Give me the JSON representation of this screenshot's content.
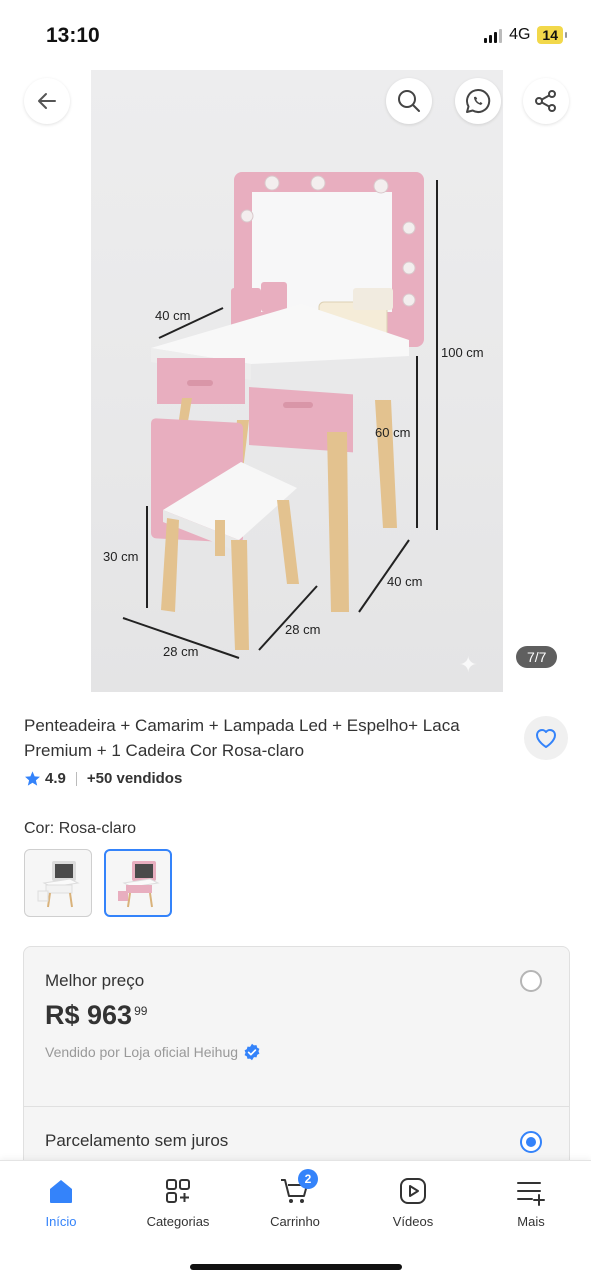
{
  "status_bar": {
    "time": "13:10",
    "network": "4G",
    "battery": "14"
  },
  "header": {
    "back_icon": "arrow-left-icon",
    "actions": [
      "search-icon",
      "whatsapp-icon",
      "share-icon"
    ]
  },
  "gallery": {
    "counter": "7/7",
    "dimensions": {
      "depth_top": "40 cm",
      "height_total": "100 cm",
      "height_table": "60 cm",
      "height_chair": "30 cm",
      "depth_floor": "40 cm",
      "chair_depth": "28 cm",
      "chair_width": "28 cm"
    }
  },
  "product": {
    "title": "Penteadeira + Camarim + Lampada Led + Espelho+ Laca Premium + 1 Cadeira Cor Rosa-claro",
    "rating": "4.9",
    "sold": "+50 vendidos",
    "color_label": "Cor:",
    "color_value": "Rosa-claro"
  },
  "buybox": {
    "best_price_label": "Melhor preço",
    "price_main": "R$ 963",
    "price_cents": "99",
    "seller": "Vendido por Loja oficial Heihug",
    "installment_label": "Parcelamento sem juros"
  },
  "bottom_nav": {
    "items": [
      {
        "label": "Início",
        "icon": "home-icon"
      },
      {
        "label": "Categorias",
        "icon": "categories-icon"
      },
      {
        "label": "Carrinho",
        "icon": "cart-icon",
        "badge": "2"
      },
      {
        "label": "Vídeos",
        "icon": "video-icon"
      },
      {
        "label": "Mais",
        "icon": "more-list-icon"
      }
    ]
  },
  "colors": {
    "accent": "#3483fa",
    "pink": "#e8aebf"
  }
}
